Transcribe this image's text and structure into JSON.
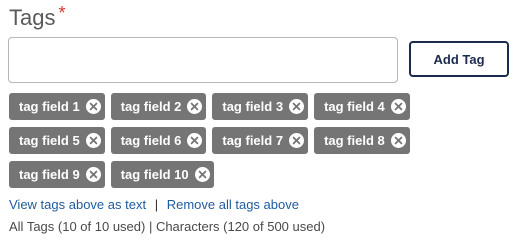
{
  "field": {
    "label": "Tags",
    "required_marker": "*",
    "input_value": "",
    "input_placeholder": ""
  },
  "add_button_label": "Add Tag",
  "tags": [
    "tag field 1",
    "tag field 2",
    "tag field 3",
    "tag field 4",
    "tag field 5",
    "tag field 6",
    "tag field 7",
    "tag field 8",
    "tag field 9",
    "tag field 10"
  ],
  "links": {
    "view_as_text": "View tags above as text",
    "separator": "|",
    "remove_all": "Remove all tags above"
  },
  "usage_text": "All Tags (10 of 10 used) | Characters (120 of 500 used)",
  "colors": {
    "required": "#d9342b",
    "chip_bg": "#757575",
    "button_border": "#1b2a4e",
    "link": "#1f5b9e"
  },
  "icons": {
    "chip_remove": "close-circle-icon"
  }
}
